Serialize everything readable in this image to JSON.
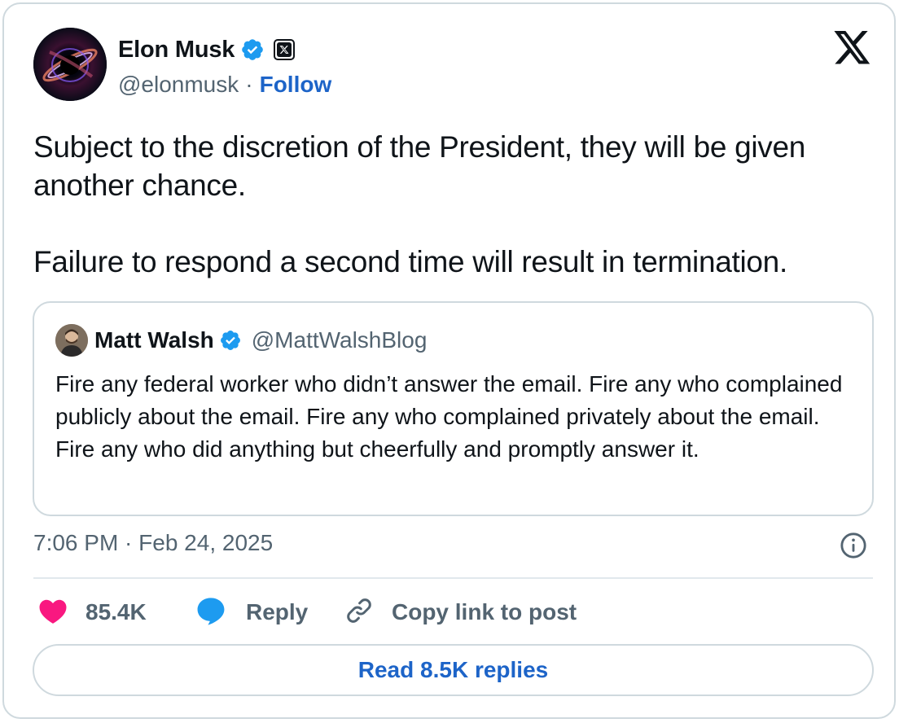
{
  "author": {
    "display_name": "Elon Musk",
    "handle": "@elonmusk",
    "separator": "·",
    "follow_label": "Follow",
    "verified": true,
    "badge_color": "#1d9bf0"
  },
  "tweet": {
    "paragraphs": [
      "Subject to the discretion of the President, they will be given another chance.",
      "Failure to respond a second time will result in termination."
    ]
  },
  "quote": {
    "display_name": "Matt Walsh",
    "handle": "@MattWalshBlog",
    "verified": true,
    "text": "Fire any federal worker who didn’t answer the email. Fire any who complained publicly about the email. Fire any who complained privately about the email. Fire any who did anything but cheerfully and promptly answer it."
  },
  "timestamp": "7:06 PM · Feb 24, 2025",
  "actions": {
    "likes": "85.4K",
    "reply_label": "Reply",
    "copy_label": "Copy link to post"
  },
  "read_replies_label": "Read 8.5K replies",
  "colors": {
    "like": "#f91880",
    "reply": "#1d9bf0",
    "link": "#1d64c8",
    "muted": "#536471",
    "border": "#cfd9de"
  },
  "icons": [
    "verified-badge-icon",
    "x-premium-badge-icon",
    "x-logo-icon",
    "info-icon",
    "heart-icon",
    "reply-bubble-icon",
    "link-icon"
  ]
}
